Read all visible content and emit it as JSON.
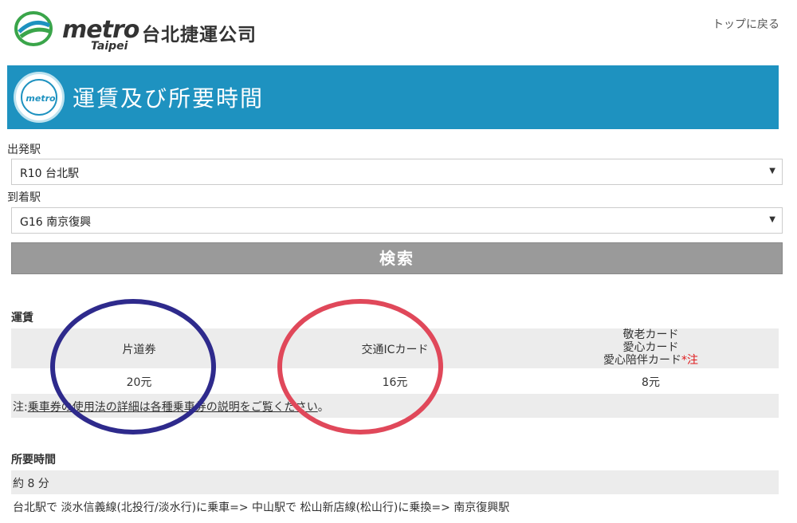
{
  "header": {
    "logo_word": "metro",
    "logo_sub": "Taipei",
    "logo_cn": "台北捷運公司",
    "top_link": "トップに戻る"
  },
  "banner": {
    "badge_text": "metro",
    "title": "運賃及び所要時間"
  },
  "form": {
    "departure_label": "出発駅",
    "departure_value": "R10 台北駅",
    "arrival_label": "到着駅",
    "arrival_value": "G16 南京復興",
    "search_label": "検索"
  },
  "fare": {
    "section_title": "運賃",
    "columns": [
      {
        "header": "片道券",
        "value": "20元"
      },
      {
        "header": "交通ICカード",
        "value": "16元"
      },
      {
        "header_lines": [
          "敬老カード",
          "愛心カード",
          "愛心陪伴カード"
        ],
        "header_mark": "*注",
        "value": "8元"
      }
    ],
    "note_prefix": "注:",
    "note_link": "乗車券の使用法の詳細は各種乗車券の説明をご覧ください",
    "note_suffix": "。"
  },
  "time": {
    "section_title": "所要時間",
    "duration": "約 8 分",
    "route": "台北駅で 淡水信義線(北投行/淡水行)に乗車=> 中山駅で 松山新店線(松山行)に乗換=> 南京復興駅"
  },
  "colors": {
    "banner": "#1e92c0",
    "annotation_blue": "#2e2a8c",
    "annotation_red": "#e0485a"
  }
}
